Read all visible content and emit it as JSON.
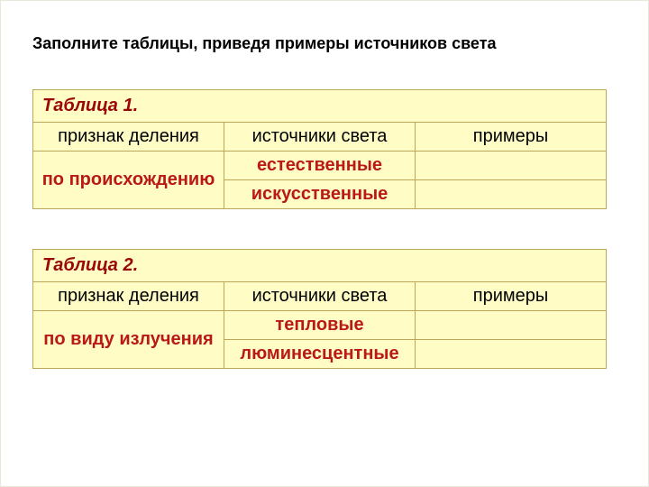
{
  "instruction": "Заполните таблицы, приведя примеры источников  света",
  "table1": {
    "caption": "Таблица 1.",
    "headers": {
      "h1": "признак деления",
      "h2": "источники света",
      "h3": "примеры"
    },
    "attribute": "по происхождению",
    "rows": [
      {
        "source": "естественные",
        "example": ""
      },
      {
        "source": "искусственные",
        "example": ""
      }
    ]
  },
  "table2": {
    "caption": "Таблица 2.",
    "headers": {
      "h1": "признак деления",
      "h2": "источники света",
      "h3": "примеры"
    },
    "attribute": "по виду излучения",
    "rows": [
      {
        "source": "тепловые",
        "example": ""
      },
      {
        "source": "люминесцентные",
        "example": ""
      }
    ]
  }
}
